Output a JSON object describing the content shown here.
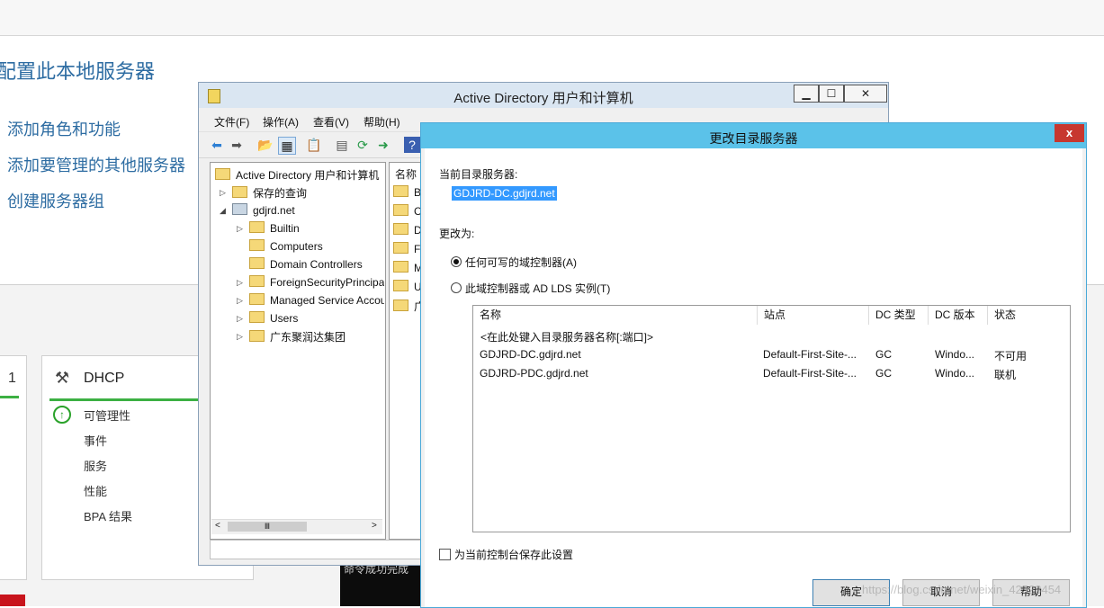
{
  "background": {
    "page_title": "配置此本地服务器",
    "links": [
      "添加角色和功能",
      "添加要管理的其他服务器",
      "创建服务器组"
    ],
    "tile_partial_number": "1",
    "dhcp_tile": {
      "title": "DHCP",
      "items": [
        "可管理性",
        "事件",
        "服务",
        "性能",
        "BPA 结果"
      ]
    },
    "cmd_text": "命令成功完成"
  },
  "aduc": {
    "title": "Active Directory 用户和计算机",
    "window_buttons": {
      "minimize": "▁",
      "maximize": "☐",
      "close": "✕"
    },
    "menu": [
      "文件(F)",
      "操作(A)",
      "查看(V)",
      "帮助(H)"
    ],
    "tree": {
      "root": "Active Directory 用户和计算机",
      "saved_queries": "保存的查询",
      "domain": "gdjrd.net",
      "children": [
        "Builtin",
        "Computers",
        "Domain Controllers",
        "ForeignSecurityPrincipals",
        "Managed Service Accounts",
        "Users",
        "广东聚润达集团"
      ]
    },
    "list_header": "名称",
    "list_items": [
      "Bu",
      "Co",
      "Do",
      "Fo",
      "M",
      "Us",
      "广"
    ],
    "scroll_thumb": "Ⅲ"
  },
  "dialog": {
    "title": "更改目录服务器",
    "close_label": "x",
    "current_label": "当前目录服务器:",
    "current_value": "GDJRD-DC.gdjrd.net",
    "change_to_label": "更改为:",
    "option_any": "任何可写的域控制器(A)",
    "option_specific": "此域控制器或 AD LDS 实例(T)",
    "selected_option": "any",
    "columns": [
      "名称",
      "站点",
      "DC 类型",
      "DC 版本",
      "状态"
    ],
    "placeholder_row": "<在此处键入目录服务器名称[:端口]>",
    "rows": [
      {
        "name": "GDJRD-DC.gdjrd.net",
        "site": "Default-First-Site-...",
        "type": "GC",
        "version": "Windo...",
        "status": "不可用"
      },
      {
        "name": "GDJRD-PDC.gdjrd.net",
        "site": "Default-First-Site-...",
        "type": "GC",
        "version": "Windo...",
        "status": "联机"
      }
    ],
    "save_setting_label": "为当前控制台保存此设置",
    "save_setting_checked": false,
    "buttons": {
      "ok": "确定",
      "cancel": "取消",
      "help": "帮助"
    }
  },
  "watermark": "https://blog.csdn.net/weixin_42523454"
}
